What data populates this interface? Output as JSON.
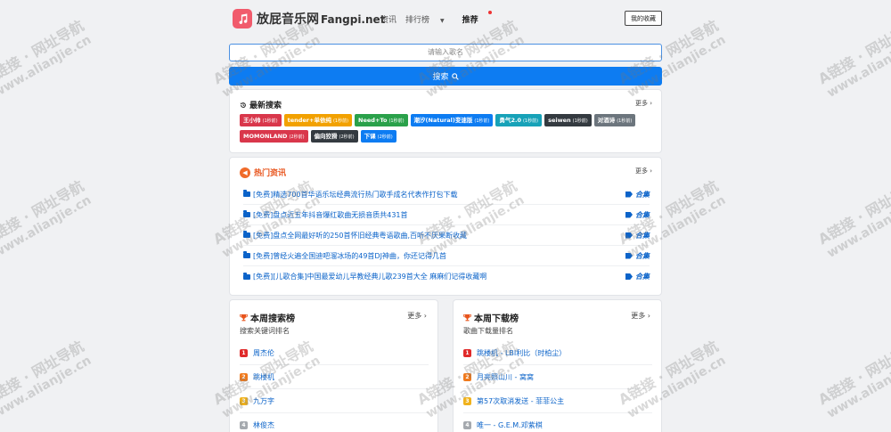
{
  "header": {
    "site_name": "放屁音乐网",
    "site_name_en": "Fangpi.net",
    "nav": [
      {
        "label": "资讯"
      },
      {
        "label": "排行榜"
      },
      {
        "label": "推荐"
      }
    ],
    "favorites_label": "我的收藏"
  },
  "search": {
    "placeholder": "请输入歌名",
    "button_label": "搜索"
  },
  "latest_search": {
    "title": "最新搜索",
    "more": "更多 ›",
    "tags": [
      {
        "name": "王小帅",
        "count": "(1秒前)",
        "color": "#d9374b"
      },
      {
        "name": "tender+单依纯",
        "count": "(1秒前)",
        "color": "#f2a100"
      },
      {
        "name": "Need+To",
        "count": "(1秒前)",
        "color": "#2aa14a"
      },
      {
        "name": "潮汐(Natural)变速版",
        "count": "(1秒前)",
        "color": "#0d7cf2"
      },
      {
        "name": "勇气2.0",
        "count": "(1秒前)",
        "color": "#17a2b8"
      },
      {
        "name": "seiwen",
        "count": "(1秒前)",
        "color": "#343a40"
      },
      {
        "name": "对酒诗",
        "count": "(1秒前)",
        "color": "#6c757d"
      },
      {
        "name": "MOMONLAND",
        "count": "(2秒前)",
        "color": "#d9374b"
      },
      {
        "name": "偏向狡猾",
        "count": "(2秒前)",
        "color": "#343a40"
      },
      {
        "name": "下课",
        "count": "(2秒前)",
        "color": "#0d7cf2"
      }
    ]
  },
  "hot_news": {
    "title": "热门资讯",
    "more": "更多 ›",
    "items": [
      {
        "title": "[免费]精选700首华语乐坛经典流行热门歌手成名代表作打包下载",
        "tag": "合集"
      },
      {
        "title": "[免费]盘点近五年抖音爆红歌曲无损音质共431首",
        "tag": "合集"
      },
      {
        "title": "[免费]盘点全网最好听的250首怀旧经典粤语歌曲,百听不厌果断收藏",
        "tag": "合集"
      },
      {
        "title": "[免费]曾经火遍全国迪吧溜冰场的49首DJ神曲，你还记得几首",
        "tag": "合集"
      },
      {
        "title": "[免费][儿歌合集]中国最爱幼儿早教经典儿歌239首大全 麻麻们记得收藏啊",
        "tag": "合集"
      }
    ]
  },
  "weekly_search": {
    "title": "本周搜索榜",
    "subtitle": "搜索关键词排名",
    "more": "更多 ›",
    "items": [
      {
        "rank": "1",
        "name": "周杰伦"
      },
      {
        "rank": "2",
        "name": "跳楼机"
      },
      {
        "rank": "3",
        "name": "九万字"
      },
      {
        "rank": "4",
        "name": "林俊杰"
      }
    ]
  },
  "weekly_download": {
    "title": "本周下载榜",
    "subtitle": "歌曲下载量排名",
    "more": "更多 ›",
    "items": [
      {
        "rank": "1",
        "name": "跳楼机 - LBI利比（时柏尘）"
      },
      {
        "rank": "2",
        "name": "月亮照山川 - 窝窝"
      },
      {
        "rank": "3",
        "name": "第57次取消发送 - 菲菲公主"
      },
      {
        "rank": "4",
        "name": "唯一 - G.E.M.邓紫棋"
      }
    ]
  },
  "watermark": {
    "line1": "A链接 · 网址导航",
    "line2": "www.alianjie.cn"
  }
}
